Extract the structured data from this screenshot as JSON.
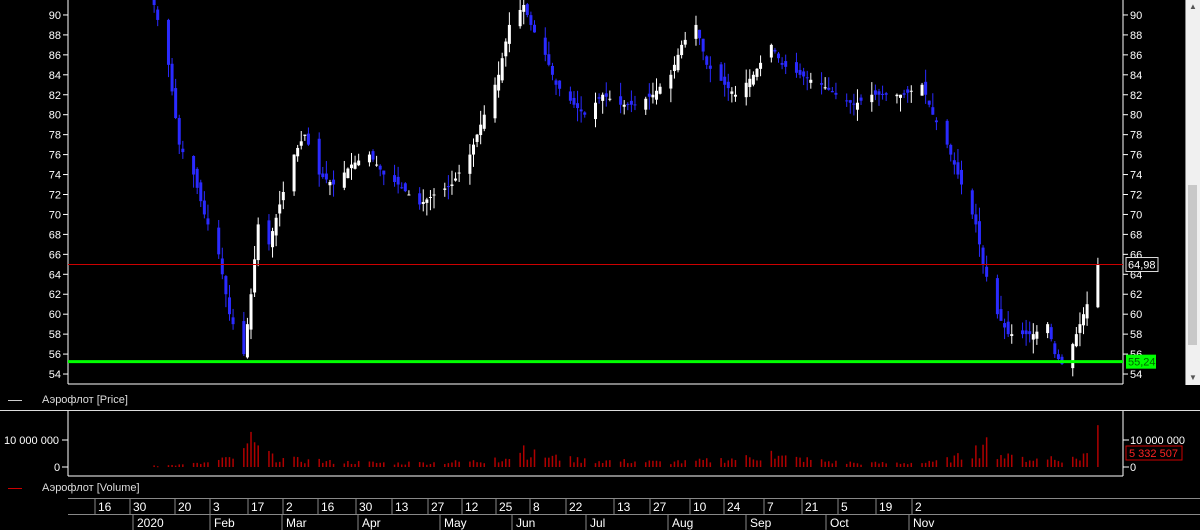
{
  "price_panel": {
    "legend_label": "Аэрофлот [Price]",
    "last_price_label": "64,98",
    "support_label": "55,24",
    "y_ticks": [
      "54",
      "56",
      "58",
      "60",
      "62",
      "64",
      "66",
      "68",
      "70",
      "72",
      "74",
      "76",
      "78",
      "80",
      "82",
      "84",
      "86",
      "88",
      "90"
    ]
  },
  "volume_panel": {
    "legend_label": "Аэрофлот [Volume]",
    "left_ticks": [
      "10 000 000",
      "0"
    ],
    "right_ticks": [
      "10 000 000",
      "0"
    ],
    "last_volume_label": "5 332 507"
  },
  "time_axis": {
    "days": [
      {
        "label": "16",
        "slot": 1
      },
      {
        "label": "30",
        "slot": 2
      },
      {
        "label": "20",
        "slot": 3
      },
      {
        "label": "3",
        "slot": 4
      },
      {
        "label": "17",
        "slot": 5
      },
      {
        "label": "2",
        "slot": 6
      },
      {
        "label": "16",
        "slot": 7
      },
      {
        "label": "30",
        "slot": 8
      },
      {
        "label": "13",
        "slot": 9
      },
      {
        "label": "27",
        "slot": 10
      },
      {
        "label": "12",
        "slot": 11
      },
      {
        "label": "25",
        "slot": 12
      },
      {
        "label": "8",
        "slot": 13
      },
      {
        "label": "22",
        "slot": 14
      },
      {
        "label": "13",
        "slot": 15
      },
      {
        "label": "27",
        "slot": 16
      },
      {
        "label": "10",
        "slot": 17
      },
      {
        "label": "24",
        "slot": 18
      },
      {
        "label": "7",
        "slot": 19
      },
      {
        "label": "21",
        "slot": 20
      },
      {
        "label": "5",
        "slot": 21
      },
      {
        "label": "19",
        "slot": 22
      },
      {
        "label": "2",
        "slot": 23
      }
    ],
    "months": [
      {
        "label": "2020",
        "slot": 1
      },
      {
        "label": "Feb",
        "slot": 2
      },
      {
        "label": "Mar",
        "slot": 3
      },
      {
        "label": "Apr",
        "slot": 4
      },
      {
        "label": "May",
        "slot": 5
      },
      {
        "label": "Jun",
        "slot": 6
      },
      {
        "label": "Jul",
        "slot": 7
      },
      {
        "label": "Aug",
        "slot": 8
      },
      {
        "label": "Sep",
        "slot": 9
      },
      {
        "label": "Oct",
        "slot": 10
      },
      {
        "label": "Nov",
        "slot": 11
      }
    ]
  },
  "colors": {
    "background": "#000000",
    "up_candle": "#ffffff",
    "down_candle": "#2a2aff",
    "last_price_line": "#cc0000",
    "support_line": "#00ff00",
    "volume_bar": "#b00000",
    "axis_text": "#ffffff"
  },
  "chart_data": {
    "type": "candlestick",
    "series": [
      {
        "name": "Аэрофлот [Price]"
      },
      {
        "name": "Аэрофлот [Volume]"
      }
    ],
    "x_range": [
      "2020-02",
      "2020-11"
    ],
    "y_range": [
      53,
      91.5
    ],
    "last_price": 64.98,
    "support_level": 55.24,
    "last_volume": 5332507,
    "close_path": [
      {
        "date": "2020-02-20",
        "close": 91
      },
      {
        "date": "2020-02-24",
        "close": 85
      },
      {
        "date": "2020-02-27",
        "close": 77
      },
      {
        "date": "2020-03-02",
        "close": 74
      },
      {
        "date": "2020-03-05",
        "close": 70
      },
      {
        "date": "2020-03-09",
        "close": 66
      },
      {
        "date": "2020-03-12",
        "close": 60
      },
      {
        "date": "2020-03-16",
        "close": 56
      },
      {
        "date": "2020-03-18",
        "close": 62
      },
      {
        "date": "2020-03-20",
        "close": 69
      },
      {
        "date": "2020-03-23",
        "close": 67
      },
      {
        "date": "2020-03-26",
        "close": 71
      },
      {
        "date": "2020-03-30",
        "close": 76
      },
      {
        "date": "2020-04-02",
        "close": 78
      },
      {
        "date": "2020-04-06",
        "close": 74
      },
      {
        "date": "2020-04-10",
        "close": 73
      },
      {
        "date": "2020-04-15",
        "close": 75
      },
      {
        "date": "2020-04-20",
        "close": 76
      },
      {
        "date": "2020-04-24",
        "close": 74
      },
      {
        "date": "2020-04-28",
        "close": 73
      },
      {
        "date": "2020-05-04",
        "close": 71
      },
      {
        "date": "2020-05-08",
        "close": 72
      },
      {
        "date": "2020-05-13",
        "close": 73
      },
      {
        "date": "2020-05-18",
        "close": 76
      },
      {
        "date": "2020-05-22",
        "close": 80
      },
      {
        "date": "2020-05-26",
        "close": 84
      },
      {
        "date": "2020-05-29",
        "close": 89
      },
      {
        "date": "2020-06-02",
        "close": 91
      },
      {
        "date": "2020-06-04",
        "close": 89
      },
      {
        "date": "2020-06-08",
        "close": 86
      },
      {
        "date": "2020-06-11",
        "close": 83
      },
      {
        "date": "2020-06-16",
        "close": 81
      },
      {
        "date": "2020-06-19",
        "close": 80
      },
      {
        "date": "2020-06-24",
        "close": 82
      },
      {
        "date": "2020-06-29",
        "close": 81
      },
      {
        "date": "2020-07-03",
        "close": 81
      },
      {
        "date": "2020-07-08",
        "close": 82
      },
      {
        "date": "2020-07-13",
        "close": 84
      },
      {
        "date": "2020-07-16",
        "close": 87
      },
      {
        "date": "2020-07-20",
        "close": 89
      },
      {
        "date": "2020-07-23",
        "close": 85
      },
      {
        "date": "2020-07-28",
        "close": 83
      },
      {
        "date": "2020-07-31",
        "close": 82
      },
      {
        "date": "2020-08-05",
        "close": 84
      },
      {
        "date": "2020-08-10",
        "close": 87
      },
      {
        "date": "2020-08-13",
        "close": 85
      },
      {
        "date": "2020-08-18",
        "close": 84
      },
      {
        "date": "2020-08-24",
        "close": 83
      },
      {
        "date": "2020-08-28",
        "close": 82
      },
      {
        "date": "2020-09-02",
        "close": 81
      },
      {
        "date": "2020-09-07",
        "close": 82
      },
      {
        "date": "2020-09-11",
        "close": 82
      },
      {
        "date": "2020-09-16",
        "close": 82
      },
      {
        "date": "2020-09-21",
        "close": 83
      },
      {
        "date": "2020-09-24",
        "close": 80
      },
      {
        "date": "2020-09-28",
        "close": 77
      },
      {
        "date": "2020-10-01",
        "close": 74
      },
      {
        "date": "2020-10-06",
        "close": 69
      },
      {
        "date": "2020-10-08",
        "close": 65
      },
      {
        "date": "2020-10-12",
        "close": 60
      },
      {
        "date": "2020-10-15",
        "close": 58
      },
      {
        "date": "2020-10-19",
        "close": 58
      },
      {
        "date": "2020-10-22",
        "close": 58
      },
      {
        "date": "2020-10-26",
        "close": 59
      },
      {
        "date": "2020-10-28",
        "close": 56
      },
      {
        "date": "2020-10-30",
        "close": 55
      },
      {
        "date": "2020-11-02",
        "close": 57
      },
      {
        "date": "2020-11-04",
        "close": 59
      },
      {
        "date": "2020-11-06",
        "close": 61
      },
      {
        "date": "2020-11-09",
        "close": 64.98
      }
    ],
    "volume_path": [
      {
        "date": "2020-02-20",
        "volume": 600000
      },
      {
        "date": "2020-03-02",
        "volume": 1500000
      },
      {
        "date": "2020-03-10",
        "volume": 3500000
      },
      {
        "date": "2020-03-16",
        "volume": 7000000
      },
      {
        "date": "2020-03-18",
        "volume": 13000000
      },
      {
        "date": "2020-03-24",
        "volume": 5000000
      },
      {
        "date": "2020-04-06",
        "volume": 3000000
      },
      {
        "date": "2020-05-01",
        "volume": 2000000
      },
      {
        "date": "2020-05-25",
        "volume": 3500000
      },
      {
        "date": "2020-06-02",
        "volume": 8000000
      },
      {
        "date": "2020-06-15",
        "volume": 4000000
      },
      {
        "date": "2020-07-15",
        "volume": 2500000
      },
      {
        "date": "2020-08-10",
        "volume": 6000000
      },
      {
        "date": "2020-09-01",
        "volume": 2000000
      },
      {
        "date": "2020-09-25",
        "volume": 2500000
      },
      {
        "date": "2020-10-06",
        "volume": 8000000
      },
      {
        "date": "2020-10-09",
        "volume": 11000000
      },
      {
        "date": "2020-10-15",
        "volume": 5000000
      },
      {
        "date": "2020-10-27",
        "volume": 4000000
      },
      {
        "date": "2020-11-05",
        "volume": 5000000
      },
      {
        "date": "2020-11-09",
        "volume": 15500000
      }
    ]
  }
}
